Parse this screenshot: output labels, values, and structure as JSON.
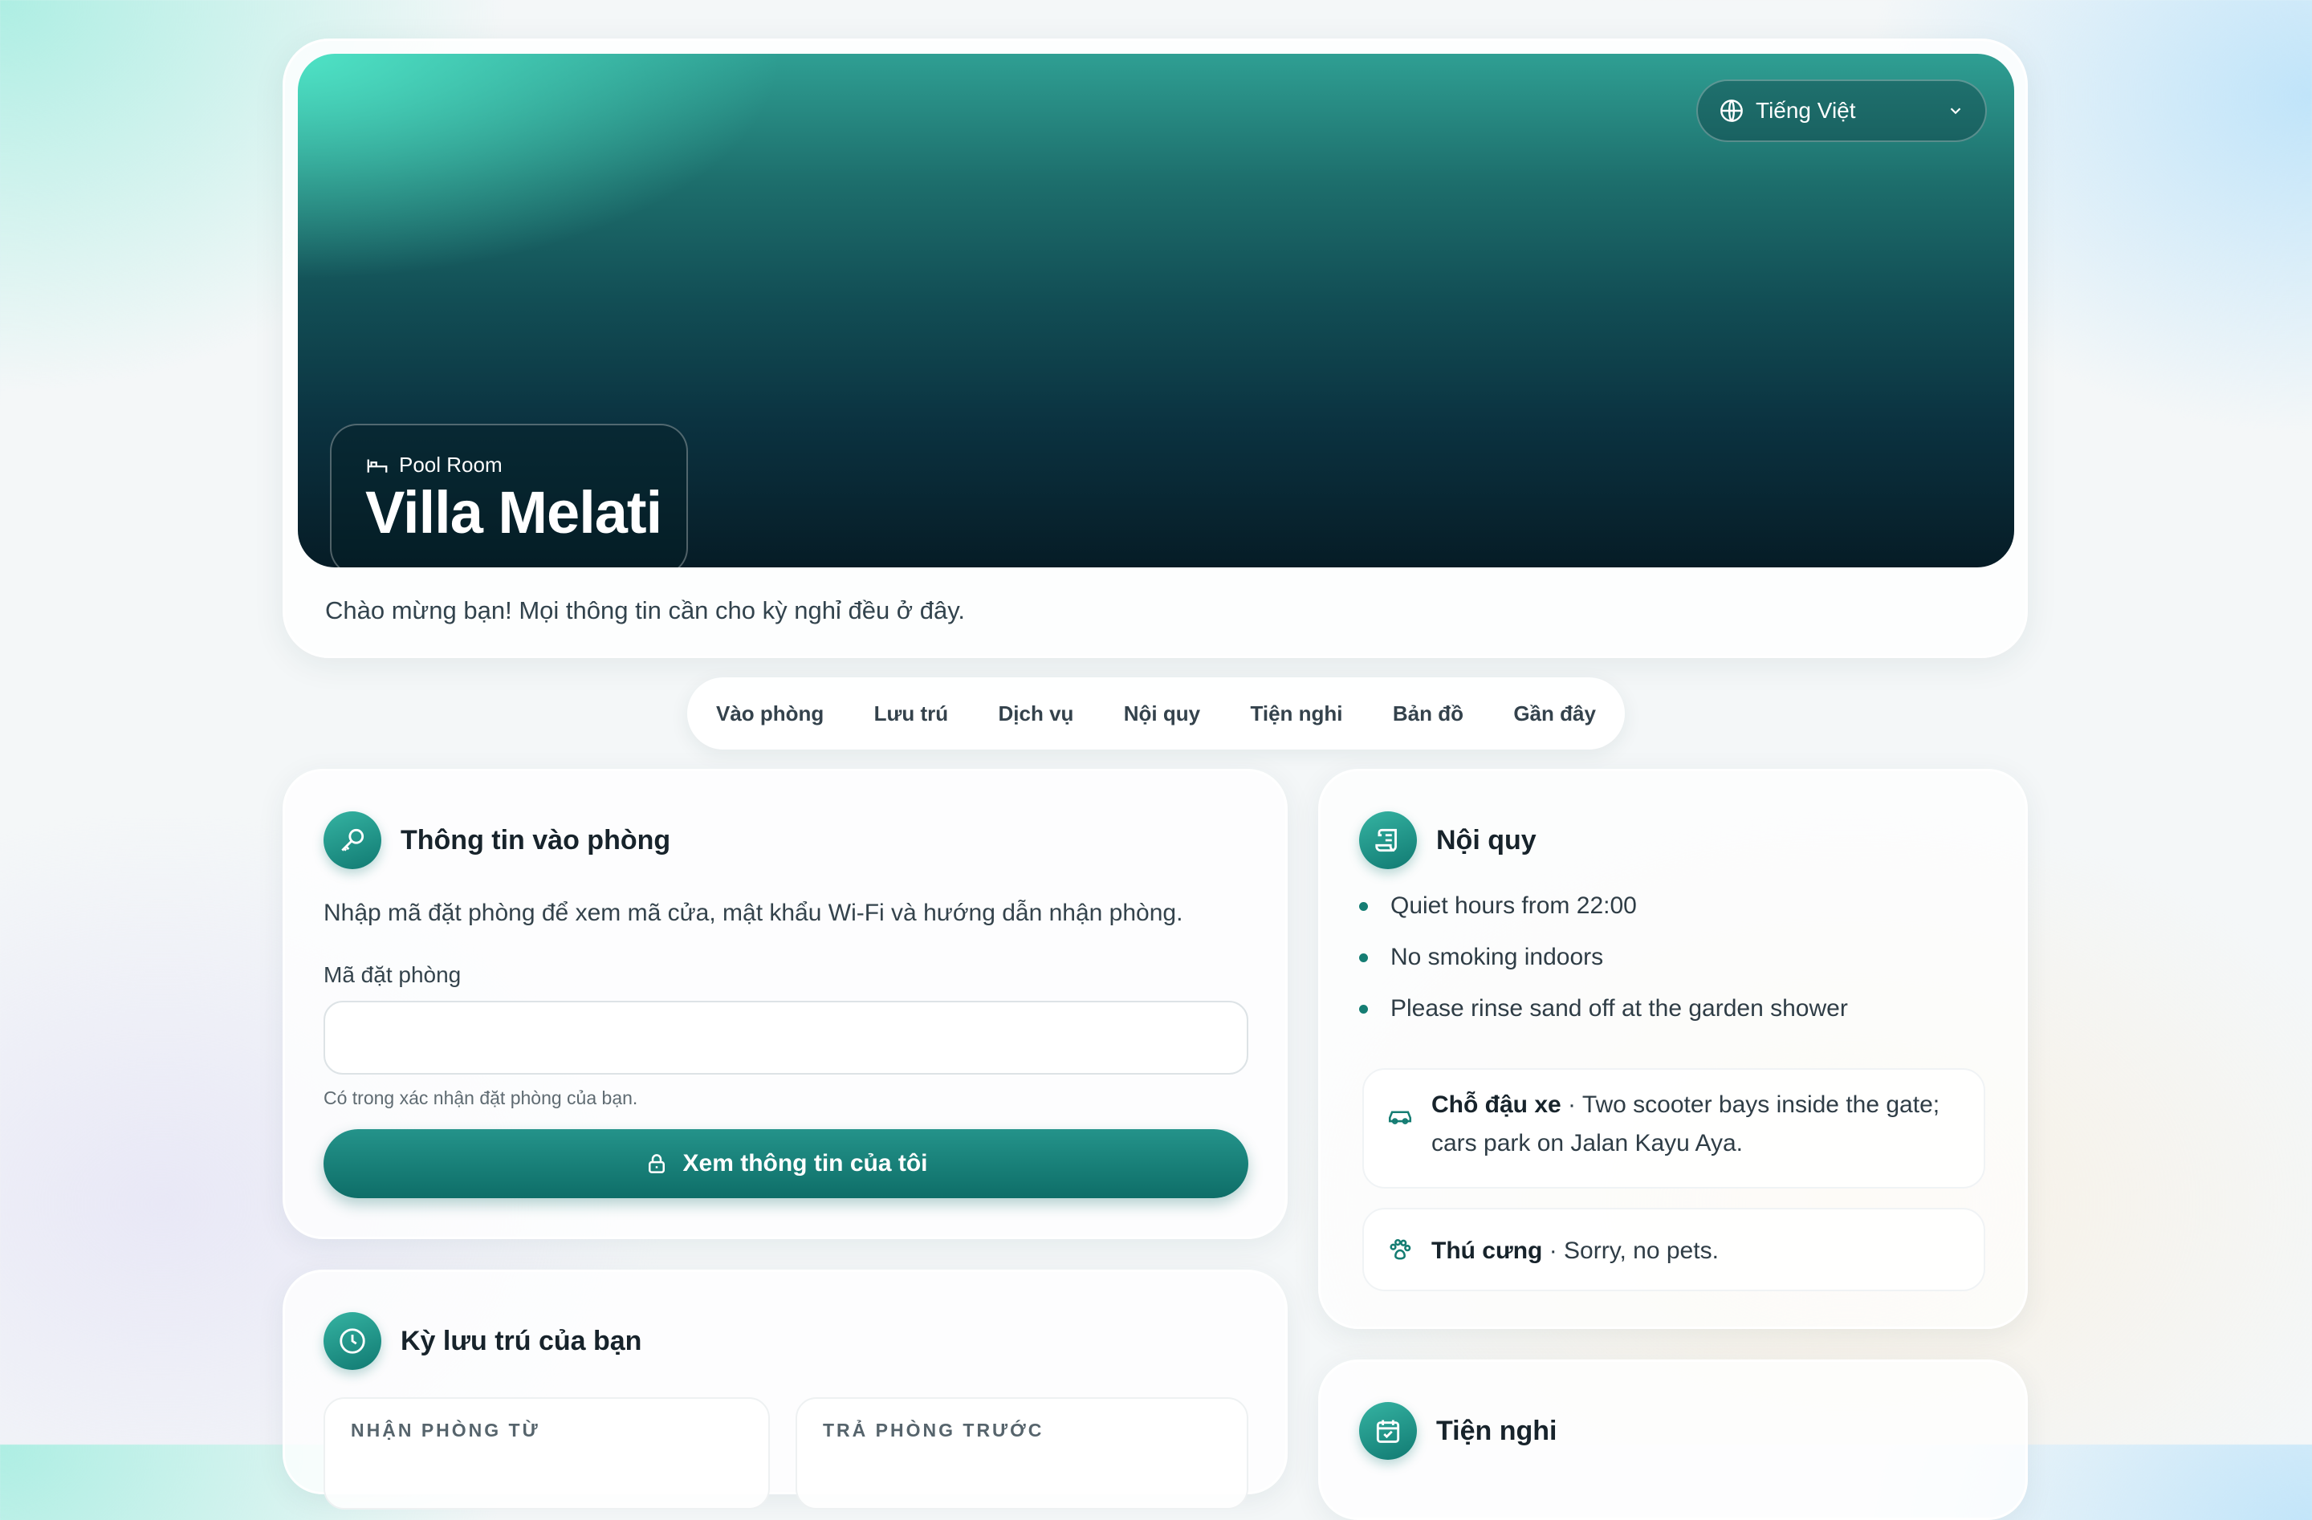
{
  "hero": {
    "language": "Tiếng Việt",
    "room_type": "Pool Room",
    "villa_name": "Villa Melati",
    "welcome": "Chào mừng bạn! Mọi thông tin cần cho kỳ nghỉ đều ở đây."
  },
  "tabs": [
    "Vào phòng",
    "Lưu trú",
    "Dịch vụ",
    "Nội quy",
    "Tiện nghi",
    "Bản đồ",
    "Gần đây"
  ],
  "checkin": {
    "title": "Thông tin vào phòng",
    "description": "Nhập mã đặt phòng để xem mã cửa, mật khẩu Wi-Fi và hướng dẫn nhận phòng.",
    "field_label": "Mã đặt phòng",
    "field_value": "",
    "hint": "Có trong xác nhận đặt phòng của bạn.",
    "button": "Xem thông tin của tôi"
  },
  "rules": {
    "title": "Nội quy",
    "items": [
      "Quiet hours from 22:00",
      "No smoking indoors",
      "Please rinse sand off at the garden shower"
    ],
    "parking": {
      "label": "Chỗ đậu xe",
      "text": "Two scooter bays inside the gate; cars park on Jalan Kayu Aya."
    },
    "pets": {
      "label": "Thú cưng",
      "text": "Sorry, no pets."
    }
  },
  "stay": {
    "title": "Kỳ lưu trú của bạn",
    "checkin_label": "NHẬN PHÒNG TỪ",
    "checkout_label": "TRẢ PHÒNG TRƯỚC"
  },
  "amenities": {
    "title": "Tiện nghi"
  },
  "icons": {
    "language": "globe-icon",
    "dropdown": "chevron-down-icon",
    "room": "bed-icon",
    "checkin": "key-icon",
    "button": "lock-icon",
    "rules": "scroll-icon",
    "parking": "car-icon",
    "pets": "paw-icon",
    "stay": "clock-icon",
    "amenities": "calendar-icon"
  },
  "colors": {
    "accent": "#117a72",
    "hero_dark": "#061c26",
    "hero_light": "#50e6c8"
  }
}
